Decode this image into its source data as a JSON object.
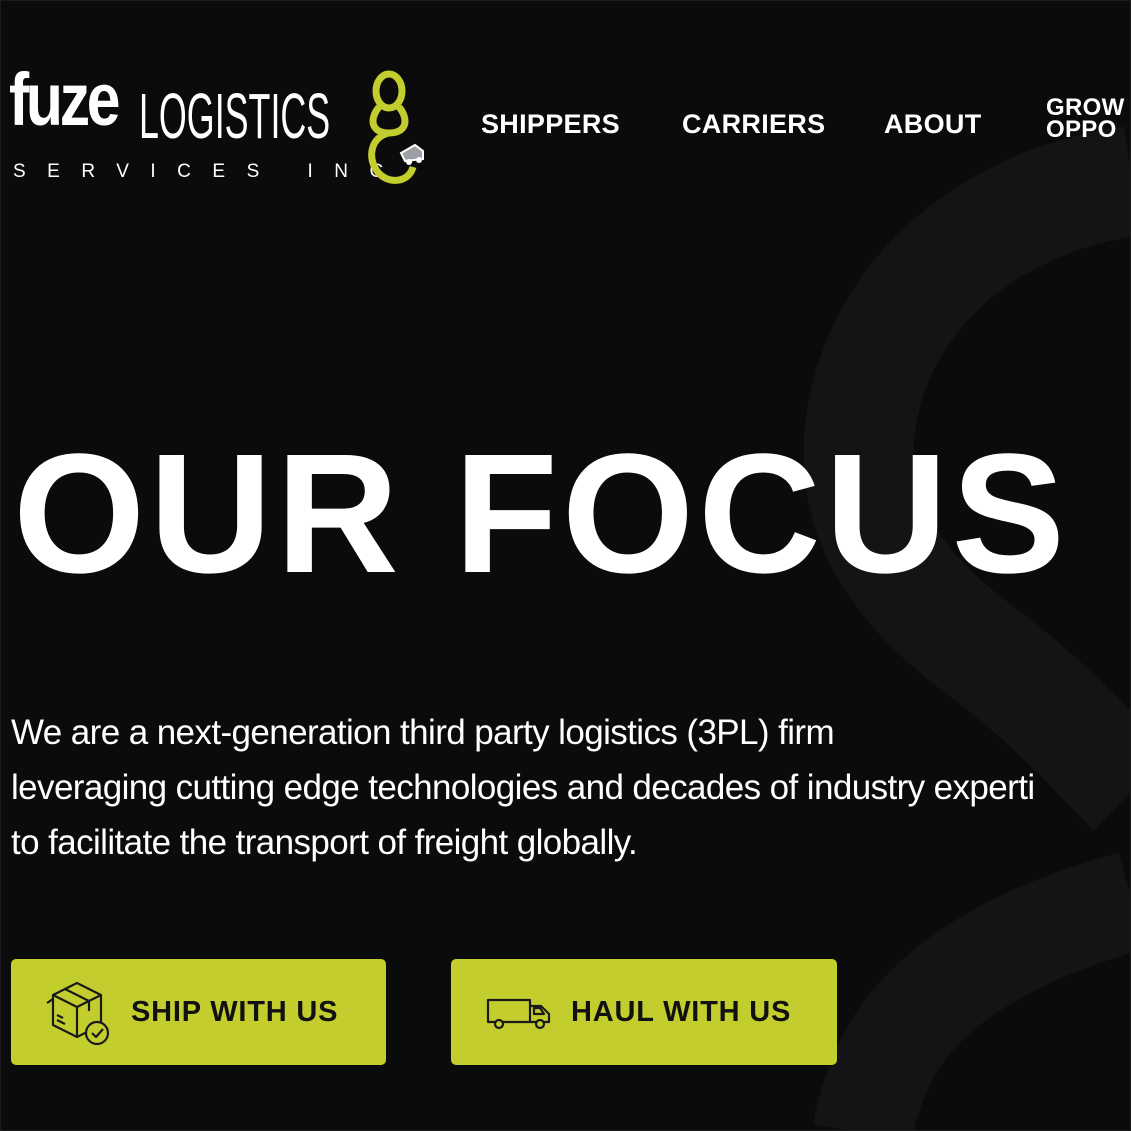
{
  "brand": {
    "name_bold": "fuze",
    "name_light": "LOGISTICS",
    "subline": "SERVICES INC",
    "accent_color": "#c3ce2e",
    "logo_icon": "infinity-eight-truck-logo-icon"
  },
  "nav": {
    "items": [
      {
        "label": "SHIPPERS"
      },
      {
        "label": "CARRIERS"
      },
      {
        "label": "ABOUT"
      },
      {
        "label": "GROW",
        "label_line2": "OPPO"
      }
    ]
  },
  "hero": {
    "title": "OUR FOCUS",
    "lines": [
      "We are a next-generation third party logistics (3PL) firm",
      "leveraging cutting edge technologies and decades of industry experti",
      "to facilitate the transport of freight globally."
    ]
  },
  "cta": {
    "ship": {
      "label": "SHIP WITH US",
      "icon": "package-check-icon"
    },
    "haul": {
      "label": "HAUL WITH US",
      "icon": "truck-icon"
    }
  },
  "colors": {
    "background": "#0b0b0c",
    "button": "#c3ce2e",
    "button_text": "#111111",
    "text": "#ffffff"
  }
}
